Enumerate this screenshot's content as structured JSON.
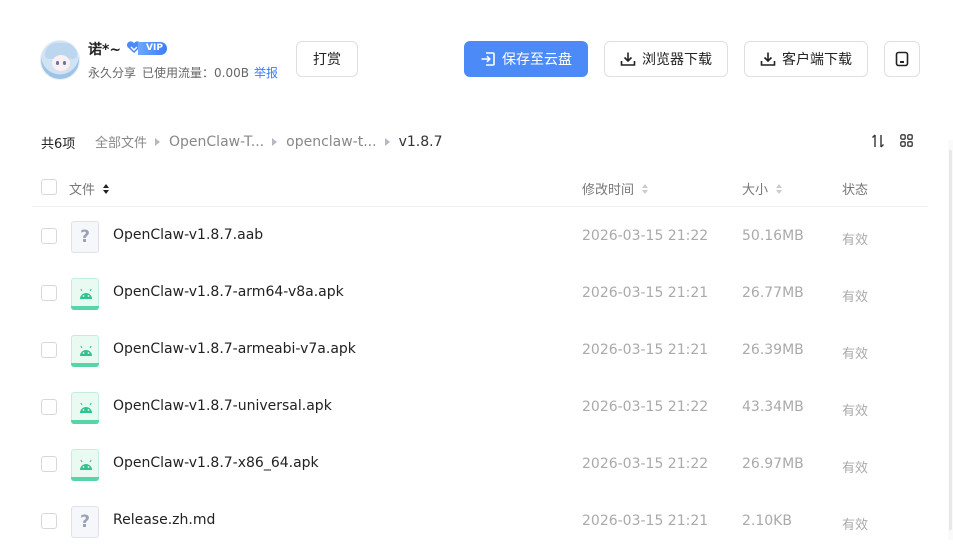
{
  "user": {
    "name": "诺*~",
    "vip_label": "VIP",
    "share_type": "永久分享",
    "traffic_used": "已使用流量：0.00B",
    "report_link": "举报"
  },
  "buttons": {
    "reward": "打赏",
    "save_to_cloud": "保存至云盘",
    "browser_download": "浏览器下载",
    "client_download": "客户端下载"
  },
  "toolbar": {
    "count": "共6项",
    "breadcrumbs": [
      "全部文件",
      "OpenClaw-T...",
      "openclaw-t...",
      "v1.8.7"
    ]
  },
  "table": {
    "headers": {
      "name": "文件",
      "modified": "修改时间",
      "size": "大小",
      "status": "状态"
    },
    "rows": [
      {
        "name": "OpenClaw-v1.8.7.aab",
        "type": "unknown",
        "modified": "2026-03-15 21:22",
        "size": "50.16MB",
        "status": "有效"
      },
      {
        "name": "OpenClaw-v1.8.7-arm64-v8a.apk",
        "type": "apk",
        "modified": "2026-03-15 21:21",
        "size": "26.77MB",
        "status": "有效"
      },
      {
        "name": "OpenClaw-v1.8.7-armeabi-v7a.apk",
        "type": "apk",
        "modified": "2026-03-15 21:21",
        "size": "26.39MB",
        "status": "有效"
      },
      {
        "name": "OpenClaw-v1.8.7-universal.apk",
        "type": "apk",
        "modified": "2026-03-15 21:22",
        "size": "43.34MB",
        "status": "有效"
      },
      {
        "name": "OpenClaw-v1.8.7-x86_64.apk",
        "type": "apk",
        "modified": "2026-03-15 21:22",
        "size": "26.97MB",
        "status": "有效"
      },
      {
        "name": "Release.zh.md",
        "type": "unknown",
        "modified": "2026-03-15 21:21",
        "size": "2.10KB",
        "status": "有效"
      }
    ]
  },
  "icons": {
    "unknown_glyph": "?",
    "save": "save-to-cloud-icon",
    "download": "download-icon",
    "square": "window-icon",
    "sort": "sort-icon",
    "view": "grid-view-icon"
  },
  "colors": {
    "primary": "#4b8af7",
    "apk_accent": "#58d4a6",
    "link": "#3c7cf6"
  }
}
